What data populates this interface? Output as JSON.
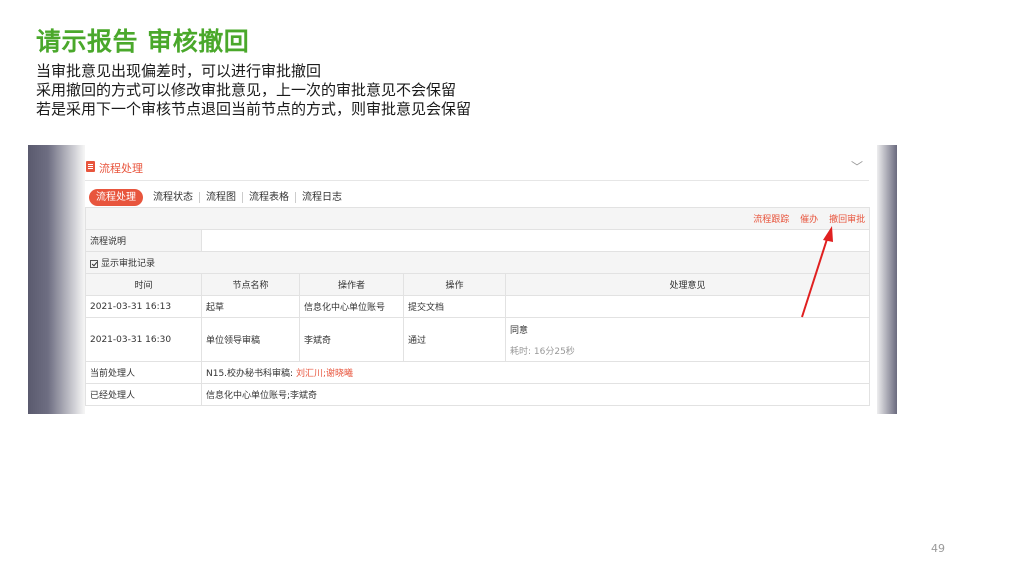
{
  "slide": {
    "title": "请示报告 审核撤回",
    "lines": [
      "当审批意见出现偏差时，可以进行审批撤回",
      "采用撤回的方式可以修改审批意见，上一次的审批意见不会保留",
      "若是采用下一个审核节点退回当前节点的方式，则审批意见会保留"
    ],
    "page_number": "49"
  },
  "panel": {
    "title": "流程处理",
    "tabs": [
      "流程处理",
      "流程状态",
      "流程图",
      "流程表格",
      "流程日志"
    ],
    "actions": [
      "流程跟踪",
      "催办",
      "撤回审批"
    ],
    "flow_desc_label": "流程说明",
    "show_records_label": "显示审批记录",
    "columns": [
      "时间",
      "节点名称",
      "操作者",
      "操作",
      "处理意见"
    ],
    "rows": [
      {
        "time": "2021-03-31 16:13",
        "node": "起草",
        "operator": "信息化中心单位账号",
        "action": "提交文档",
        "opinion": "",
        "elapsed": ""
      },
      {
        "time": "2021-03-31 16:30",
        "node": "单位领导审稿",
        "operator": "李斌奇",
        "action": "通过",
        "opinion": "同意",
        "elapsed": "耗时: 16分25秒"
      }
    ],
    "current_handler_label": "当前处理人",
    "current_node": "N15.校办秘书科审稿:",
    "current_handlers": "刘汇川;谢晓曦",
    "past_handler_label": "已经处理人",
    "past_handlers": "信息化中心单位账号;李斌奇"
  },
  "colors": {
    "title_green": "#4aa82b",
    "accent_red": "#e8553d"
  }
}
